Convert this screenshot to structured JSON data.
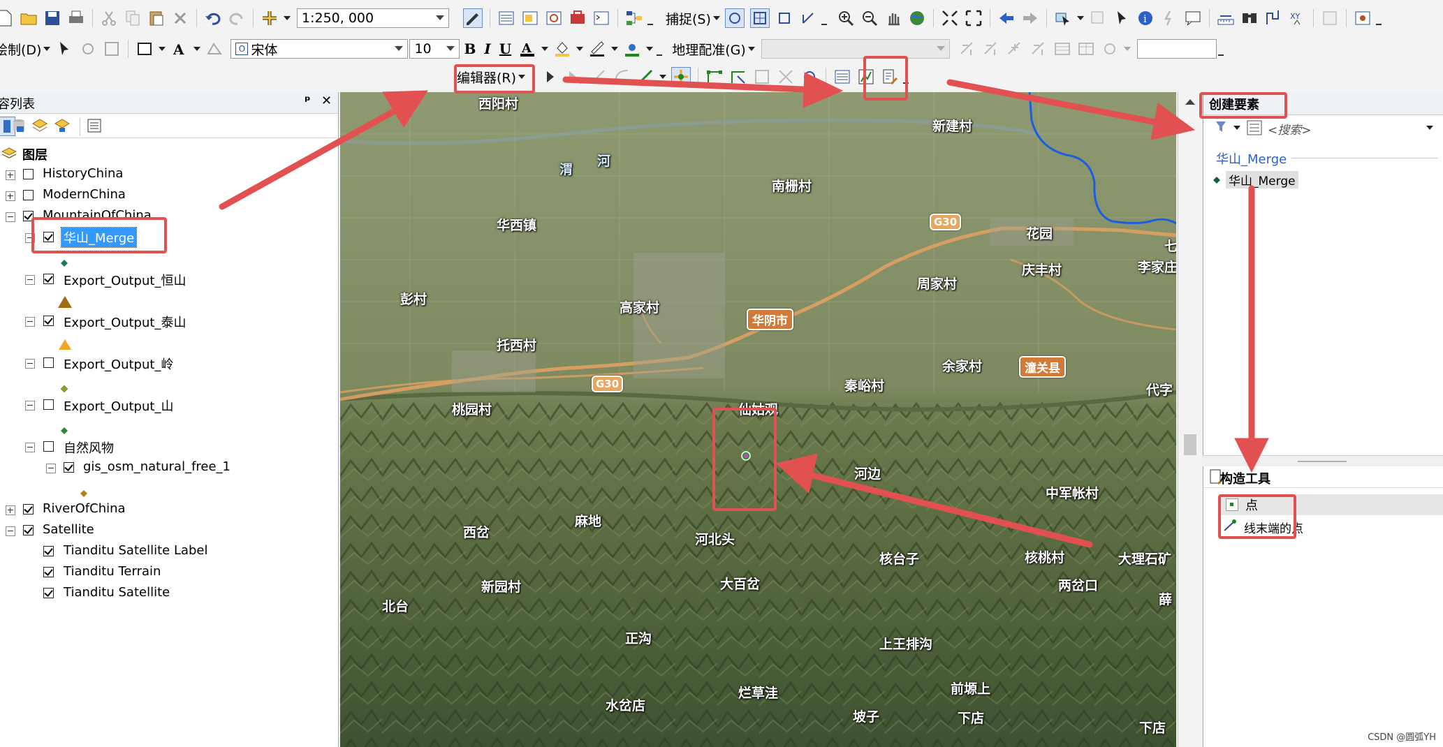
{
  "toolbar1": {
    "scale_value": "1:250, 000",
    "snapping_label": "捕捉(S)"
  },
  "toolbar2": {
    "draw_label": "绘制(D)",
    "font_name": "宋体",
    "font_size": "10",
    "georef_label": "地理配准(G)"
  },
  "toolbar3": {
    "editor_label": "编辑器(R)"
  },
  "toc": {
    "title": "容列表",
    "pin": "ᵖ",
    "close": "✕",
    "root": "图层",
    "layers": [
      {
        "label": "HistoryChina",
        "checked": false
      },
      {
        "label": "ModernChina",
        "checked": false
      },
      {
        "label": "MountainOfChina",
        "checked": true
      },
      {
        "label": "华山_Merge",
        "checked": true
      },
      {
        "label": "Export_Output_恒山",
        "checked": true
      },
      {
        "label": "Export_Output_泰山",
        "checked": true
      },
      {
        "label": "Export_Output_岭",
        "checked": false
      },
      {
        "label": "Export_Output_山",
        "checked": false
      },
      {
        "label": "自然风物",
        "checked": false
      },
      {
        "label": "gis_osm_natural_free_1",
        "checked": true
      },
      {
        "label": "RiverOfChina",
        "checked": true
      },
      {
        "label": "Satellite",
        "checked": true
      },
      {
        "label": "Tianditu Satellite Label",
        "checked": true
      },
      {
        "label": "Tianditu Terrain",
        "checked": true
      },
      {
        "label": "Tianditu Satellite",
        "checked": true
      }
    ]
  },
  "map": {
    "labels": [
      "西阳村",
      "新建村",
      "渭",
      "河",
      "南栅村",
      "华西镇",
      "花园",
      "彭村",
      "庆丰村",
      "周家村",
      "李家庄",
      "高家村",
      "托西村",
      "秦峪村",
      "余家村",
      "代字",
      "桃园村",
      "仙姑观",
      "河边",
      "中军帐村",
      "西岔",
      "麻地",
      "河北头",
      "核台子",
      "核桃村",
      "大理石矿",
      "新园村",
      "大百岔",
      "两岔口",
      "北台",
      "正沟",
      "上王排沟",
      "薛",
      "水岔店",
      "烂草洼",
      "前塬上",
      "坡子",
      "下店",
      "下店",
      "七"
    ],
    "shields": [
      "G30",
      "G30"
    ],
    "cities": [
      "华阴市",
      "潼关县"
    ]
  },
  "create_features": {
    "title": "创建要素",
    "search_placeholder": "<搜索>",
    "group_label": "华山_Merge",
    "template_label": "华山_Merge"
  },
  "construction_tools": {
    "title": "构造工具",
    "tools": [
      "点",
      "线末端的点"
    ]
  },
  "watermark": "CSDN @圆弧YH",
  "colors": {
    "annotation_red": "#e25151",
    "selection_blue": "#3399ff",
    "river_blue": "#1a5fe0",
    "road_orange": "#e0a060"
  }
}
